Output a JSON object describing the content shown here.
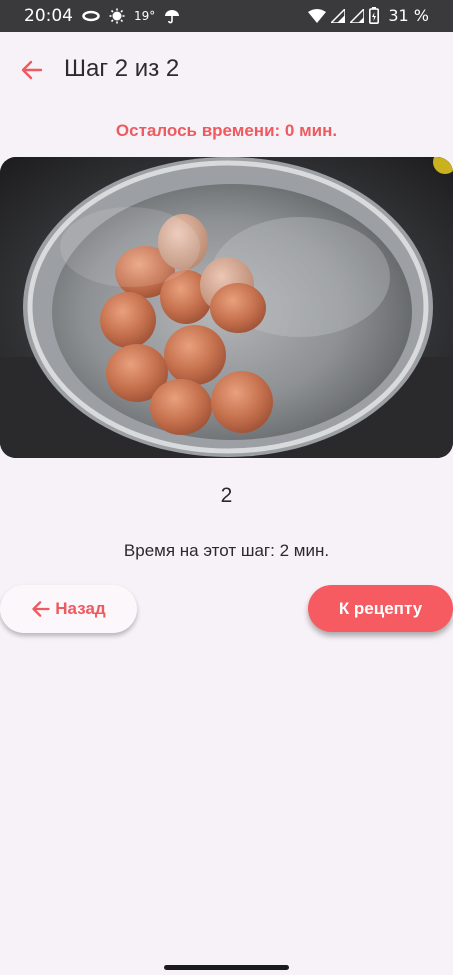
{
  "status_bar": {
    "time": "20:04",
    "temperature": "19°",
    "battery": "31 %",
    "icons": [
      "infinity-icon",
      "weather-icon",
      "umbrella-icon",
      "wifi-icon",
      "signal-icon",
      "signal-icon",
      "battery-icon"
    ]
  },
  "appbar": {
    "title": "Шаг 2 из 2",
    "back_icon": "arrow-back-icon"
  },
  "timer": {
    "remaining_text": "Осталось времени: 0 мин."
  },
  "step": {
    "number": "2",
    "time_text": "Время на этот шаг: 2 мин."
  },
  "buttons": {
    "back_label": "Назад",
    "recipe_label": "К рецепту"
  },
  "colors": {
    "accent": "#ee5a5f",
    "primary_button": "#f55b60",
    "background": "#f6f2f7",
    "status_bar": "#3a3a3d"
  }
}
